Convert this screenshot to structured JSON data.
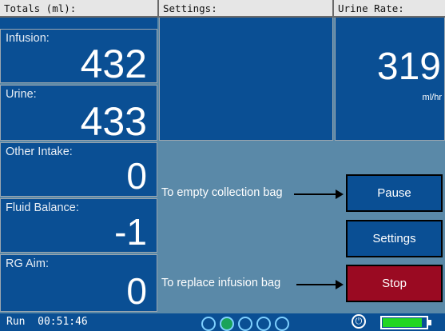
{
  "headers": {
    "totals": "Totals (ml):",
    "settings": "Settings:",
    "urine_rate": "Urine Rate:"
  },
  "totals": {
    "infusion": {
      "label": "Infusion:",
      "value": "432"
    },
    "urine": {
      "label": "Urine:",
      "value": "433"
    },
    "other_intake": {
      "label": "Other Intake:",
      "value": "0"
    },
    "fluid_balance": {
      "label": "Fluid Balance:",
      "value": "-1"
    },
    "rg_aim": {
      "label": "RG Aim:",
      "value": "0"
    }
  },
  "urine_rate": {
    "value": "319",
    "unit": "ml/hr"
  },
  "actions": {
    "empty_bag_text": "To empty collection bag",
    "replace_bag_text": "To replace infusion bag",
    "pause_label": "Pause",
    "settings_label": "Settings",
    "stop_label": "Stop"
  },
  "status": {
    "run_text": "Run  00:51:46",
    "progress_dots": {
      "total": 5,
      "active_index": 1
    },
    "battery_level": 0.95,
    "colors": {
      "panel": "#0a4f94",
      "stop": "#9a0a22",
      "battery": "#22d622",
      "dot_active": "#1aa35a"
    }
  }
}
